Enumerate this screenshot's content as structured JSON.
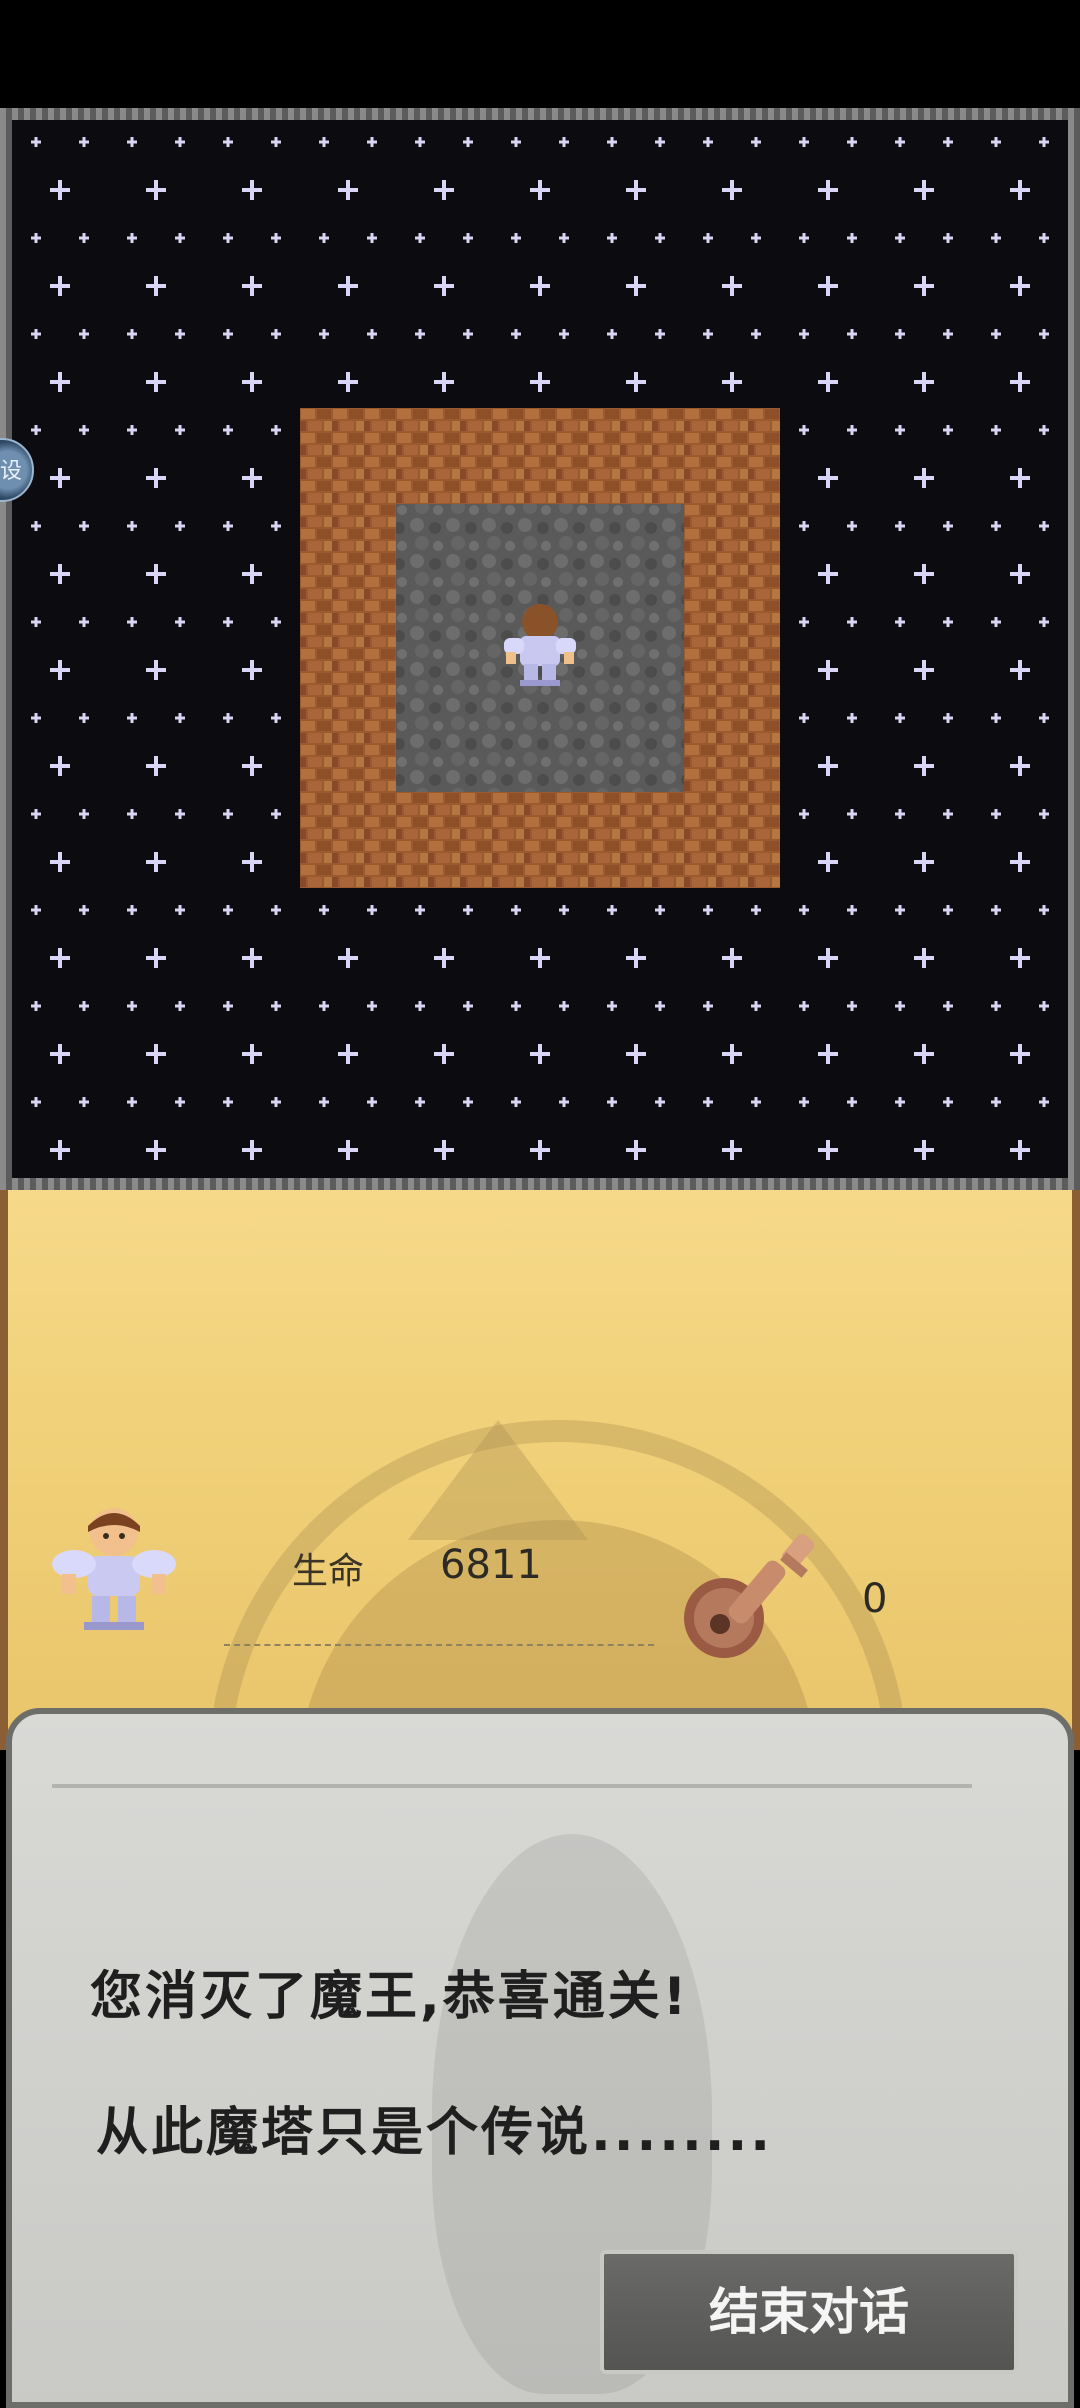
{
  "side_handle": {
    "label": "设"
  },
  "hero": {
    "stat_label": "生命",
    "hp": "6811"
  },
  "inventory": {
    "key_count": "0"
  },
  "dialog": {
    "line1": "您消灭了魔王,恭喜通关!",
    "line2": "从此魔塔只是个传说........",
    "end_button": "结束对话"
  },
  "colors": {
    "star": "#d9d6f5",
    "brick": "#9a5a2e",
    "stone": "#555555",
    "panel": "#f1d27a",
    "dialog": "#d0d0cd"
  }
}
